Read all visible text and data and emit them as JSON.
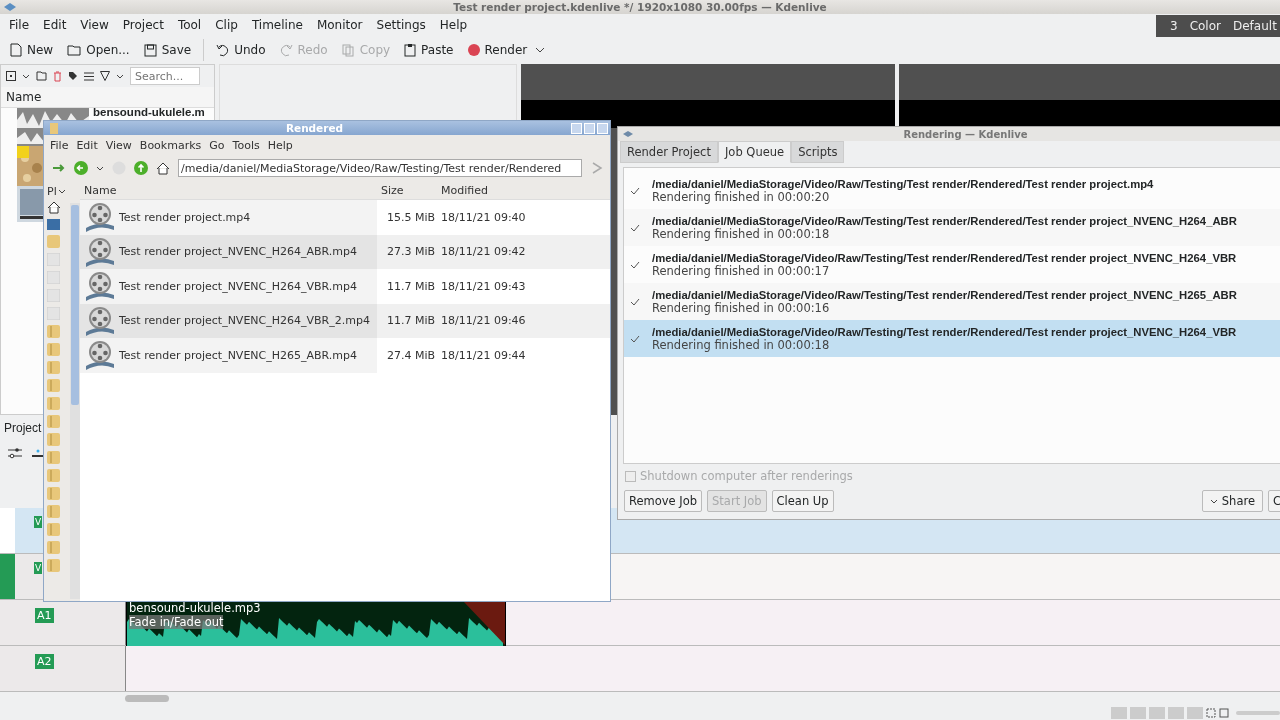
{
  "window": {
    "title": "Test render project.kdenlive */ 1920x1080 30.00fps — Kdenlive"
  },
  "menu": [
    "File",
    "Edit",
    "View",
    "Project",
    "Tool",
    "Clip",
    "Timeline",
    "Monitor",
    "Settings",
    "Help"
  ],
  "toolbar": [
    {
      "label": "New",
      "disabled": false
    },
    {
      "label": "Open...",
      "disabled": false
    },
    {
      "label": "Save",
      "disabled": false
    },
    {
      "label": "Undo",
      "disabled": false
    },
    {
      "label": "Redo",
      "disabled": true
    },
    {
      "label": "Copy",
      "disabled": true
    },
    {
      "label": "Paste",
      "disabled": false
    },
    {
      "label": "Render",
      "disabled": false
    }
  ],
  "layouts": [
    "3",
    "Color",
    "Default"
  ],
  "bin": {
    "search": {
      "placeholder": "Search..."
    },
    "column": "Name",
    "clip": "bensound-ukulele.m"
  },
  "project_tab": "Project",
  "file_manager": {
    "title": "Rendered",
    "menu": [
      "File",
      "Edit",
      "View",
      "Bookmarks",
      "Go",
      "Tools",
      "Help"
    ],
    "path": "/media/daniel/MediaStorage/Video/Raw/Testing/Test render/Rendered",
    "places_header": "Pl",
    "columns": [
      "Name",
      "Size",
      "Modified"
    ],
    "files": [
      {
        "name": "Test render project.mp4",
        "size": "15.5 MiB",
        "modified": "18/11/21 09:40"
      },
      {
        "name": "Test render project_NVENC_H264_ABR.mp4",
        "size": "27.3 MiB",
        "modified": "18/11/21 09:42"
      },
      {
        "name": "Test render project_NVENC_H264_VBR.mp4",
        "size": "11.7 MiB",
        "modified": "18/11/21 09:43"
      },
      {
        "name": "Test render project_NVENC_H264_VBR_2.mp4",
        "size": "11.7 MiB",
        "modified": "18/11/21 09:46"
      },
      {
        "name": "Test render project_NVENC_H265_ABR.mp4",
        "size": "27.4 MiB",
        "modified": "18/11/21 09:44"
      }
    ]
  },
  "render_dialog": {
    "title": "Rendering — Kdenlive",
    "tabs": [
      {
        "label": "Render Project",
        "selected": false
      },
      {
        "label": "Job Queue",
        "selected": true
      },
      {
        "label": "Scripts",
        "selected": false
      }
    ],
    "jobs": [
      {
        "path": "/media/daniel/MediaStorage/Video/Raw/Testing/Test render/Rendered/Test render project.mp4",
        "status": "Rendering finished in 00:00:20",
        "finished": true,
        "selected": false
      },
      {
        "path": "/media/daniel/MediaStorage/Video/Raw/Testing/Test render/Rendered/Test render project_NVENC_H264_ABR",
        "status": "Rendering finished in 00:00:18",
        "finished": true,
        "selected": false
      },
      {
        "path": "/media/daniel/MediaStorage/Video/Raw/Testing/Test render/Rendered/Test render project_NVENC_H264_VBR",
        "status": "Rendering finished in 00:00:17",
        "finished": true,
        "selected": false
      },
      {
        "path": "/media/daniel/MediaStorage/Video/Raw/Testing/Test render/Rendered/Test render project_NVENC_H265_ABR",
        "status": "Rendering finished in 00:00:16",
        "finished": true,
        "selected": false
      },
      {
        "path": "/media/daniel/MediaStorage/Video/Raw/Testing/Test render/Rendered/Test render project_NVENC_H264_VBR",
        "status": "Rendering finished in 00:00:18",
        "finished": true,
        "selected": true
      }
    ],
    "shutdown": {
      "label": "Shutdown computer after renderings",
      "checked": false,
      "disabled": true
    },
    "buttons": [
      {
        "label": "Remove Job",
        "disabled": false
      },
      {
        "label": "Start Job",
        "disabled": true
      },
      {
        "label": "Clean Up",
        "disabled": false
      }
    ],
    "share": "Share",
    "cut_button": "C"
  },
  "timeline": {
    "tracks": [
      {
        "label": "V",
        "kind": "video"
      },
      {
        "label": "V",
        "kind": "video"
      },
      {
        "label": "A1",
        "kind": "audio"
      },
      {
        "label": "A2",
        "kind": "audio"
      }
    ],
    "clip": {
      "name": "bensound-ukulele.mp3",
      "effect": "Fade in/Fade out"
    }
  }
}
